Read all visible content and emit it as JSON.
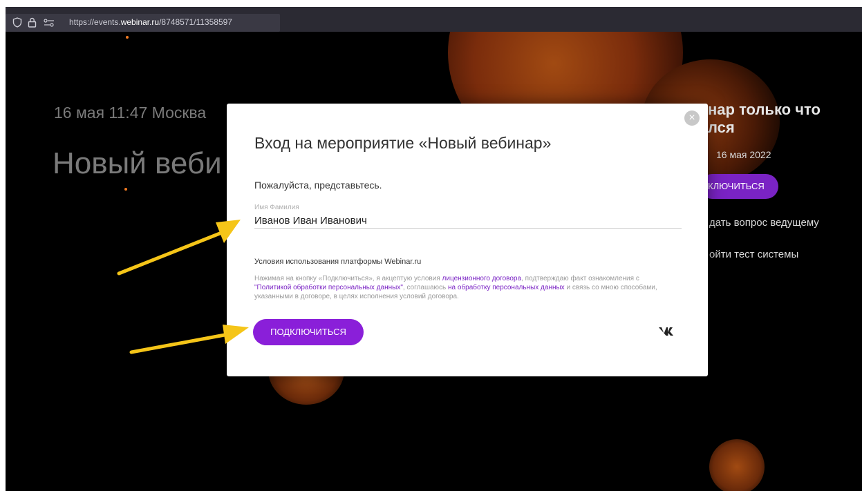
{
  "browser": {
    "url_prefix": "https://events.",
    "url_domain": "webinar.ru",
    "url_path": "/8748571/11358597",
    "icons": [
      "shield-icon",
      "lock-icon",
      "permissions-icon"
    ]
  },
  "background": {
    "date_line": "16 мая 11:47 Москва",
    "title": "Новый веби",
    "status_line1": "нар только что",
    "status_line2": "лся",
    "date_small": "16 мая 2022",
    "button_label": "КЛЮЧИТЬСЯ",
    "link_question": "дать вопрос ведущему",
    "link_test": "ойти тест системы"
  },
  "modal": {
    "close_icon": "×",
    "title": "Вход на мероприятие «Новый вебинар»",
    "intro": "Пожалуйста, представьтесь.",
    "field_label": "Имя Фамилия",
    "field_value": "Иванов Иван Иванович",
    "terms_title": "Условия использования платформы Webinar.ru",
    "terms_part1": "Нажимая на кнопку «Подключиться», я акцептую условия ",
    "terms_link1": "лицензионного договора",
    "terms_part2": ", подтверждаю факт ознакомления с ",
    "terms_link2": "\"Политикой обработки персональных данных\"",
    "terms_part3": ", соглашаюсь ",
    "terms_link3": "на обработку персональных данных",
    "terms_part4": " и связь со мною способами, указанными в договоре, в целях исполнения условий договора.",
    "connect_label": "ПОДКЛЮЧИТЬСЯ",
    "vk_label": "VK"
  },
  "colors": {
    "accent": "#8a1fd9",
    "link": "#7a23c4",
    "annotation_arrow": "#f5c518"
  }
}
